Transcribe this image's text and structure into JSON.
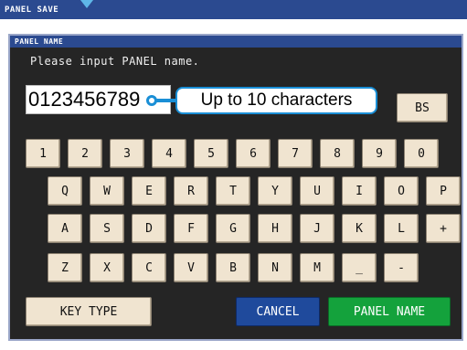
{
  "window": {
    "title": "PANEL SAVE"
  },
  "dialog": {
    "title": "PANEL NAME",
    "prompt": "Please input PANEL name.",
    "input_value": "0123456789"
  },
  "callout": {
    "text": "Up to 10 characters"
  },
  "keys": {
    "bs": "BS",
    "row1": [
      "1",
      "2",
      "3",
      "4",
      "5",
      "6",
      "7",
      "8",
      "9",
      "0"
    ],
    "row2": [
      "Q",
      "W",
      "E",
      "R",
      "T",
      "Y",
      "U",
      "I",
      "O",
      "P"
    ],
    "row3": [
      "A",
      "S",
      "D",
      "F",
      "G",
      "H",
      "J",
      "K",
      "L",
      "+"
    ],
    "row4": [
      "Z",
      "X",
      "C",
      "V",
      "B",
      "N",
      "M",
      "_",
      "-"
    ]
  },
  "buttons": {
    "key_type": "KEY TYPE",
    "cancel": "CANCEL",
    "panel_name": "PANEL NAME"
  },
  "colors": {
    "title_bar": "#2b4a90",
    "dialog_bg": "#252525",
    "key_bg": "#f0e4d0",
    "cancel": "#1f4a9c",
    "panel_name": "#14a23c",
    "callout": "#1a8fd6"
  },
  "icons": {
    "title_pointer": "triangle-down-icon"
  }
}
